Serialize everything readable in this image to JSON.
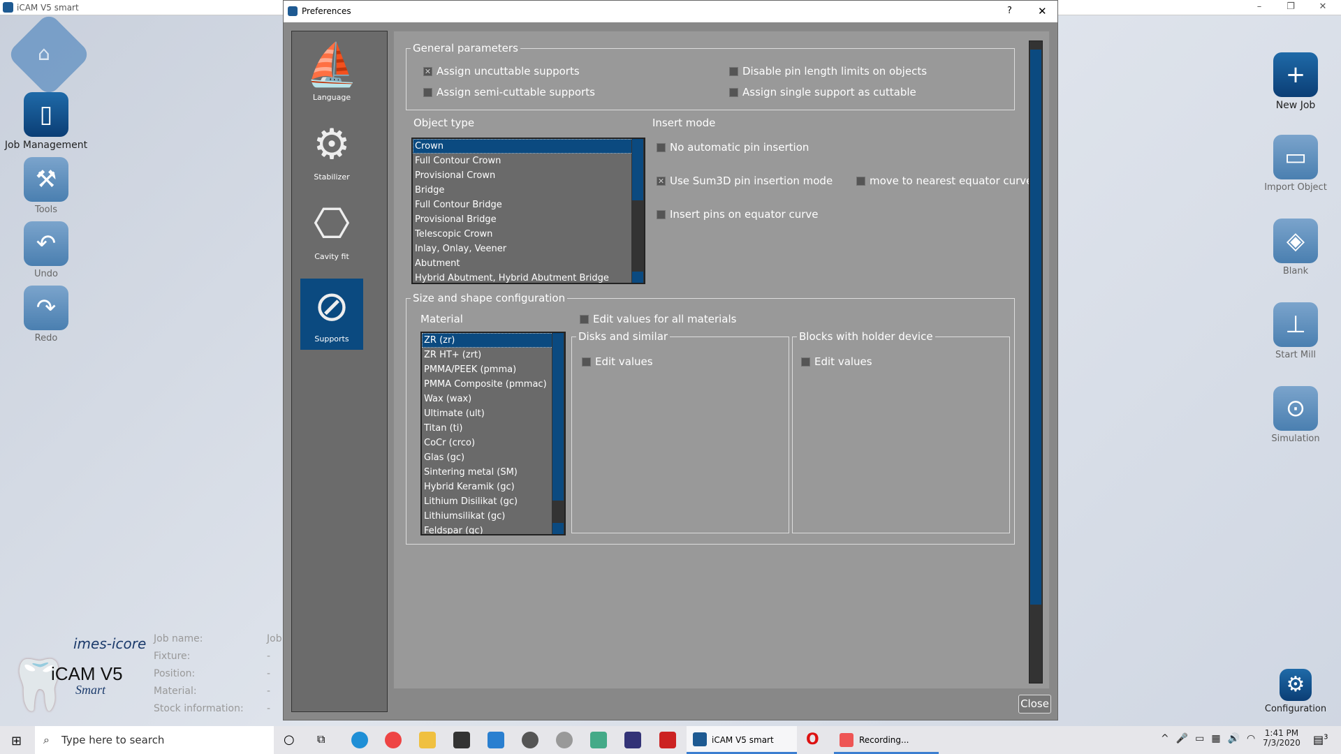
{
  "app": {
    "title": "iCAM V5 smart",
    "left_tools": [
      "Job Management",
      "Tools",
      "Undo",
      "Redo"
    ],
    "right_tools": [
      "New Job",
      "Import Object",
      "Blank",
      "Start Mill",
      "Simulation",
      "Configuration"
    ],
    "logo": {
      "brand": "imes-icore",
      "product": "iCAM V5",
      "edition": "Smart"
    },
    "info": [
      {
        "label": "Job name:",
        "value": "Job"
      },
      {
        "label": "Fixture:",
        "value": "-"
      },
      {
        "label": "Position:",
        "value": "-"
      },
      {
        "label": "Material:",
        "value": "-"
      },
      {
        "label": "Stock information:",
        "value": "-"
      }
    ]
  },
  "dialog": {
    "title": "Preferences",
    "help": "?",
    "close_x": "✕",
    "close_button": "Close",
    "nav": [
      {
        "label": "Language"
      },
      {
        "label": "Stabilizer"
      },
      {
        "label": "Cavity fit"
      },
      {
        "label": "Supports",
        "selected": true
      }
    ],
    "general": {
      "title": "General parameters",
      "options": [
        {
          "label": "Assign uncuttable supports",
          "checked": true
        },
        {
          "label": "Disable pin length limits on objects",
          "checked": false
        },
        {
          "label": "Assign semi-cuttable supports",
          "checked": false
        },
        {
          "label": "Assign single support as cuttable",
          "checked": false
        }
      ]
    },
    "object_type": {
      "label": "Object type",
      "selected": "Crown",
      "items": [
        "Crown",
        "Full Contour Crown",
        "Provisional Crown",
        "Bridge",
        "Full Contour Bridge",
        "Provisional Bridge",
        "Telescopic Crown",
        "Inlay, Onlay, Veener",
        "Abutment",
        "Hybrid Abutment, Hybrid Abutment Bridge"
      ]
    },
    "insert_mode": {
      "label": "Insert mode",
      "options": [
        {
          "label": "No automatic pin insertion",
          "checked": false
        },
        {
          "label": "Use Sum3D pin insertion mode",
          "checked": true
        },
        {
          "label": "move to nearest equator curve",
          "checked": false
        },
        {
          "label": "Insert pins on equator curve",
          "checked": false
        }
      ]
    },
    "size_shape": {
      "title": "Size and shape configuration",
      "material_label": "Material",
      "edit_all": "Edit values for all materials",
      "materials": [
        "ZR (zr)",
        "ZR HT+ (zrt)",
        "PMMA/PEEK (pmma)",
        "PMMA Composite (pmmac)",
        "Wax (wax)",
        "Ultimate (ult)",
        "Titan (ti)",
        "CoCr (crco)",
        "Glas (gc)",
        "Sintering metal (SM)",
        "Hybrid Keramik (gc)",
        "Lithium Disilikat (gc)",
        "Lithiumsilikat (gc)",
        "Feldspar (gc)"
      ],
      "disks": {
        "title": "Disks and similar",
        "edit": "Edit values"
      },
      "blocks": {
        "title": "Blocks with holder device",
        "edit": "Edit values"
      }
    }
  },
  "taskbar": {
    "search_placeholder": "Type here to search",
    "apps": [
      "iCAM V5 smart",
      "Recording..."
    ],
    "time": "1:41 PM",
    "date": "7/3/2020",
    "notifications": "3"
  }
}
